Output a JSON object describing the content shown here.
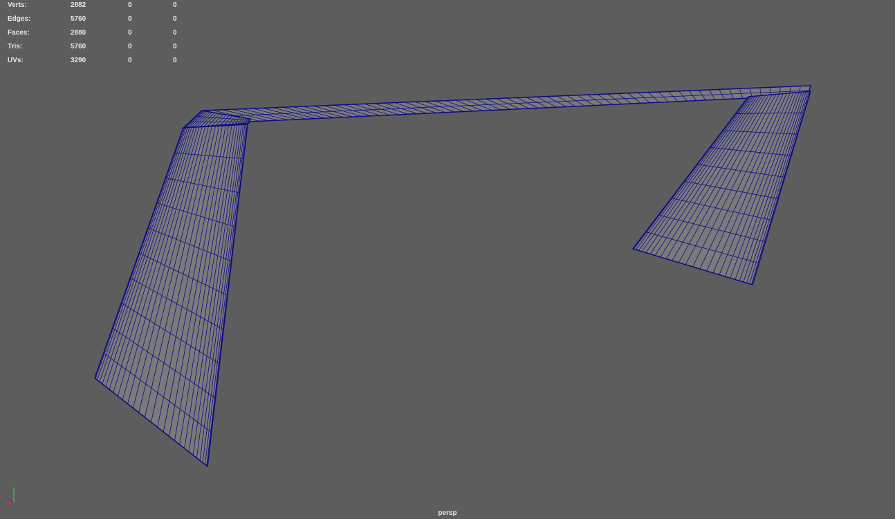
{
  "hud": {
    "rows": [
      {
        "label": "Verts:",
        "values": [
          "2882",
          "0",
          "0"
        ]
      },
      {
        "label": "Edges:",
        "values": [
          "5760",
          "0",
          "0"
        ]
      },
      {
        "label": "Faces:",
        "values": [
          "2880",
          "0",
          "0"
        ]
      },
      {
        "label": "Tris:",
        "values": [
          "5760",
          "0",
          "0"
        ]
      },
      {
        "label": "UVs:",
        "values": [
          "3290",
          "0",
          "0"
        ]
      }
    ]
  },
  "camera_label": "persp",
  "axis": {
    "y_label": "y",
    "z_label": "z"
  },
  "colors": {
    "background": "#5d5d5d",
    "wire": "#0c0c86",
    "surface": "#7a7a7a"
  }
}
